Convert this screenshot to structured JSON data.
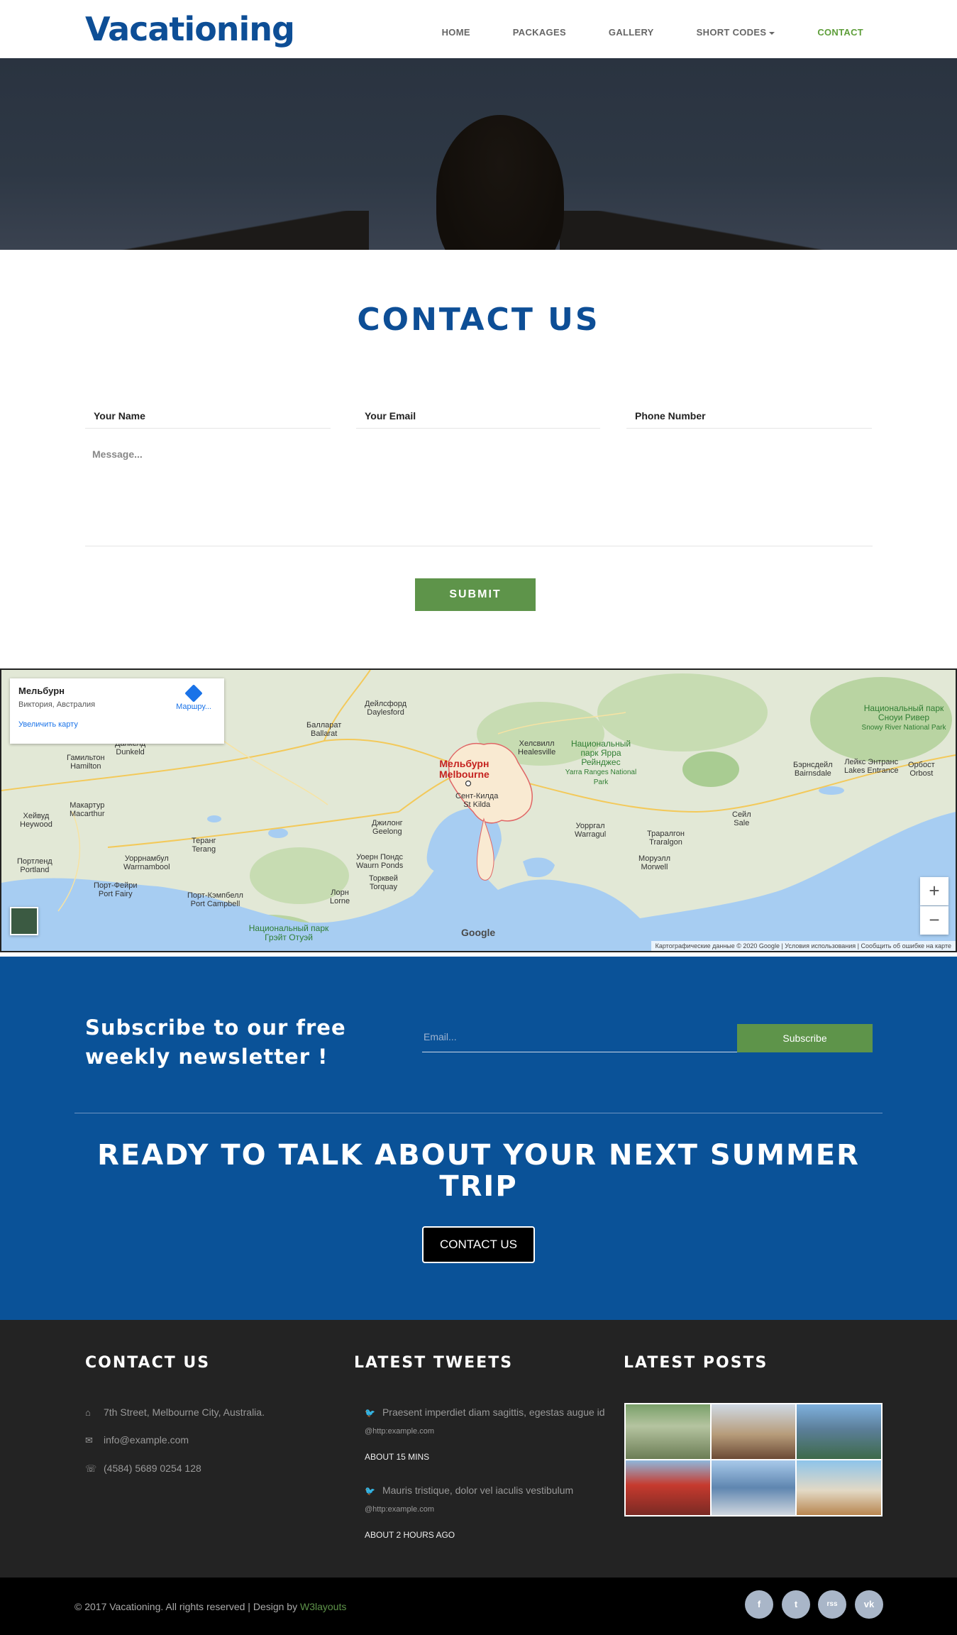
{
  "header": {
    "logo": "Vacationing",
    "nav": [
      "HOME",
      "PACKAGES",
      "GALLERY",
      "SHORT CODES",
      "CONTACT"
    ],
    "active": "CONTACT"
  },
  "contact": {
    "title": "CONTACT US",
    "name_placeholder": "Your Name",
    "email_placeholder": "Your Email",
    "phone_placeholder": "Phone Number",
    "message_placeholder": "Message...",
    "submit": "SUBMIT"
  },
  "map": {
    "card_title": "Мельбурн",
    "card_subtitle": "Виктория, Австралия",
    "card_link": "Увеличить карту",
    "route": "Маршру...",
    "city_ru": "Мельбурн",
    "city_en": "Melbourne",
    "labels": [
      {
        "ru": "Балларат",
        "en": "Ballarat"
      },
      {
        "ru": "Дейлсфорд",
        "en": "Daylesford"
      },
      {
        "ru": "Гамильтон",
        "en": "Hamilton"
      },
      {
        "ru": "Данкелд",
        "en": "Dunkeld"
      },
      {
        "ru": "Макартур",
        "en": "Macarthur"
      },
      {
        "ru": "Хейвуд",
        "en": "Heywood"
      },
      {
        "ru": "Портленд",
        "en": "Portland"
      },
      {
        "ru": "Уоррнамбул",
        "en": "Warrnambool"
      },
      {
        "ru": "Теранг",
        "en": "Terang"
      },
      {
        "ru": "Порт-Фейри",
        "en": "Port Fairy"
      },
      {
        "ru": "Порт-Кэмпбелл",
        "en": "Port Campbell"
      },
      {
        "ru": "Джилонг",
        "en": "Geelong"
      },
      {
        "ru": "Уоерн Пондс",
        "en": "Waurn Ponds"
      },
      {
        "ru": "Торквей",
        "en": "Torquay"
      },
      {
        "ru": "Лорн",
        "en": "Lorne"
      },
      {
        "ru": "Сент-Килда",
        "en": "St Kilda"
      },
      {
        "ru": "Хелсвилл",
        "en": "Healesville"
      },
      {
        "ru": "Уорргал",
        "en": "Warragul"
      },
      {
        "ru": "Траралгон",
        "en": "Traralgon"
      },
      {
        "ru": "Моруэлл",
        "en": "Morwell"
      },
      {
        "ru": "Сейл",
        "en": "Sale"
      },
      {
        "ru": "Бэрнсдейл",
        "en": "Bairnsdale"
      },
      {
        "ru": "Лейкс Энтранс",
        "en": "Lakes Entrance"
      },
      {
        "ru": "Орбост",
        "en": "Orbost"
      }
    ],
    "parks": [
      "Национальный парк Ярра Рейнджес",
      "Национальный парк Сноуи Ривер",
      "Национальный парк Грэйт Отуэй"
    ],
    "parks_en": [
      "Yarra Ranges National Park",
      "Snowy River National Park"
    ],
    "google": "Google",
    "attribution": "Картографические данные © 2020 Google | Условия использования | Сообщить об ошибке на карте",
    "zoom_in": "+",
    "zoom_out": "−"
  },
  "newsletter": {
    "text_line1": "Subscribe to our free",
    "text_line2": "weekly newsletter !",
    "email_placeholder": "Email...",
    "button": "Subscribe"
  },
  "cta": {
    "title_line1": "READY TO TALK ABOUT YOUR NEXT SUMMER",
    "title_line2": "TRIP",
    "button": "CONTACT US"
  },
  "footer": {
    "contact_title": "CONTACT US",
    "address": "7th Street, Melbourne City, Australia.",
    "email": "info@example.com",
    "phone": "(4584) 5689 0254 128",
    "tweets_title": "LATEST TWEETS",
    "tweets": [
      {
        "text": "Praesent imperdiet diam sagittis, egestas augue id",
        "link": "@http:example.com",
        "time": "ABOUT 15 MINS"
      },
      {
        "text": "Mauris tristique, dolor vel iaculis vestibulum",
        "link": "@http:example.com",
        "time": "ABOUT 2 HOURS AGO"
      }
    ],
    "posts_title": "LATEST POSTS",
    "copyright": "© 2017 Vacationing. All rights reserved | Design by",
    "designer": "W3layouts",
    "social": [
      "f",
      "t",
      "rss",
      "vk"
    ]
  },
  "colors": {
    "brand_blue": "#0d4e96",
    "accent_green": "#5e944a",
    "section_blue": "#0a5298",
    "footer_dark": "#232323"
  }
}
